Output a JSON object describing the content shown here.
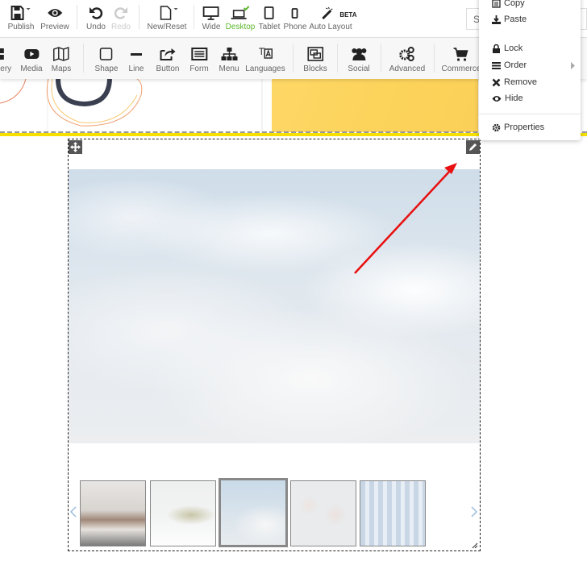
{
  "toolbar_top": {
    "publish": "Publish",
    "preview": "Preview",
    "undo": "Undo",
    "redo": "Redo",
    "new_reset": "New/Reset",
    "wide": "Wide",
    "desktop": "Desktop",
    "tablet": "Tablet",
    "phone": "Phone",
    "auto_layout": "Auto Layout",
    "beta": "BETA",
    "search_placeholder": "S"
  },
  "toolbar_elements": {
    "gallery": "llery",
    "media": "Media",
    "maps": "Maps",
    "shape": "Shape",
    "line": "Line",
    "button": "Button",
    "form": "Form",
    "menu": "Menu",
    "languages": "Languages",
    "blocks": "Blocks",
    "social": "Social",
    "advanced": "Advanced",
    "commerce": "Commerce"
  },
  "context_menu": {
    "copy": "Copy",
    "paste": "Paste",
    "lock": "Lock",
    "order": "Order",
    "remove": "Remove",
    "hide": "Hide",
    "properties": "Properties"
  },
  "colors": {
    "accent_active": "#5cb82e",
    "highlight": "#f7e000",
    "arrow": "#e81010",
    "block": "#fcd35a"
  },
  "gallery": {
    "thumbnails": [
      "room",
      "crown",
      "clouds",
      "orchids",
      "forest"
    ],
    "selected_index": 2
  }
}
